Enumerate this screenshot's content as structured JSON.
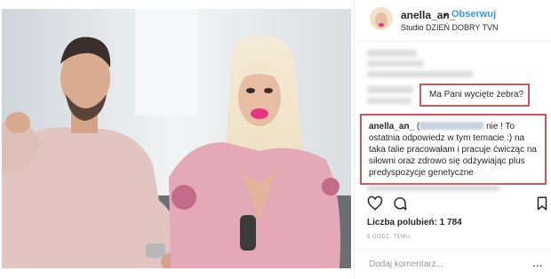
{
  "post": {
    "username": "anella_an_",
    "separator": "•",
    "follow_label": "Obserwuj",
    "location": "Studio DZIEŃ DOBRY TVN"
  },
  "comments": {
    "question": "Ma Pani wycięte żebra?",
    "answer_user": "anella_an_",
    "answer_open": "(",
    "answer_text": "nie ! To ostatnia odpowiedz w tym temacie :) na taka talie pracowałam i pracuje ćwicząc na siłowni oraz zdrowo się odżywiając plus predyspozycje genetyczne"
  },
  "stats": {
    "likes_label": "Liczba polubień:",
    "likes_count": "1 784",
    "time": "5 GODZ. TEMU"
  },
  "comment_box": {
    "placeholder": "Dodaj komentarz...",
    "more": "..."
  },
  "icons": [
    "heart-icon",
    "comment-icon",
    "bookmark-icon",
    "avatar-image"
  ],
  "colors": {
    "follow": "#3897f0",
    "highlight_border": "#c7575b",
    "text": "#262626",
    "muted": "#999999"
  }
}
